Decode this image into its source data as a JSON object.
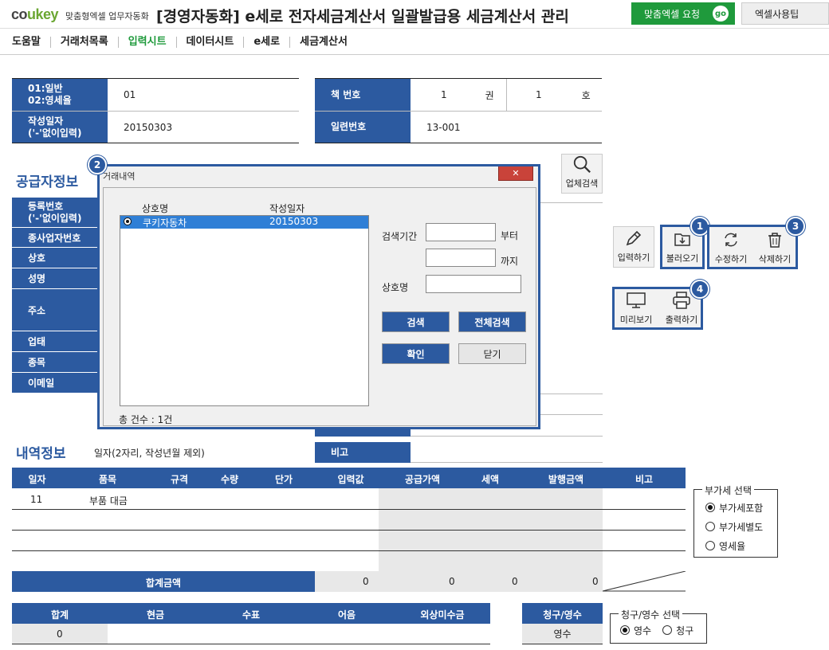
{
  "header": {
    "logo_co": "co",
    "logo_ukey": "ukey",
    "logo_sub": "맞춤형엑셀 업무자동화",
    "title": "[경영자동화] e세로 전자세금계산서 일괄발급용 세금계산서 관리",
    "request_btn": "맞춤엑셀 요청",
    "go": "go",
    "tip_btn": "엑셀사용팁"
  },
  "nav": [
    "도움말",
    "거래처목록",
    "입력시트",
    "데이터시트",
    "e세로",
    "세금계산서"
  ],
  "top_form": {
    "type_label": "01:일반\n02:영세율",
    "type_value": "01",
    "date_label": "작성일자\n('-'없이입력)",
    "date_value": "20150303",
    "book_label": "책 번호",
    "book_vol": "1",
    "book_vol_unit": "권",
    "book_no": "1",
    "book_no_unit": "호",
    "serial_label": "일련번호",
    "serial_value": "13-001"
  },
  "supplier": {
    "title": "공급자정보",
    "labels": [
      "등록번호\n('-'없이입력)",
      "종사업자번호",
      "상호",
      "성명",
      "주소",
      "업태",
      "종목",
      "이메일"
    ],
    "search_btn": "업체검색"
  },
  "actions": {
    "input": "입력하기",
    "load": "불러오기",
    "edit": "수정하기",
    "delete": "삭제하기",
    "preview": "미리보기",
    "print": "출력하기",
    "badges": [
      "1",
      "2",
      "3",
      "4"
    ]
  },
  "dialog": {
    "title": "거래내역",
    "col_name": "상호명",
    "col_date": "작성일자",
    "rows": [
      {
        "name": "쿠키자동차",
        "date": "20150303"
      }
    ],
    "period_label": "검색기간",
    "from_label": "부터",
    "to_label": "까지",
    "name_label": "상호명",
    "search_btn": "검색",
    "all_search_btn": "전체검색",
    "ok_btn": "확인",
    "close_btn": "닫기",
    "total": "총 건수 : 1건",
    "close_x": "✕"
  },
  "detail": {
    "title": "내역정보",
    "note": "일자(2자리, 작성년월 제외)",
    "remark_label": "비고",
    "headers": [
      "일자",
      "품목",
      "규격",
      "수량",
      "단가",
      "입력값",
      "공급가액",
      "세액",
      "발행금액",
      "비고"
    ],
    "rows": [
      {
        "day": "11",
        "item": "부품 대금"
      }
    ],
    "total_label": "합계금액",
    "totals": [
      "0",
      "0",
      "0",
      "0"
    ]
  },
  "vat": {
    "title": "부가세 선택",
    "options": [
      "부가세포함",
      "부가세별도",
      "영세율"
    ],
    "selected": 0
  },
  "payment": {
    "headers": [
      "합계",
      "현금",
      "수표",
      "어음",
      "외상미수금"
    ],
    "sum_value": "0",
    "claim_header": "청구/영수",
    "claim_value": "영수"
  },
  "claim": {
    "title": "청구/영수 선택",
    "options": [
      "영수",
      "청구"
    ],
    "selected": 0
  }
}
